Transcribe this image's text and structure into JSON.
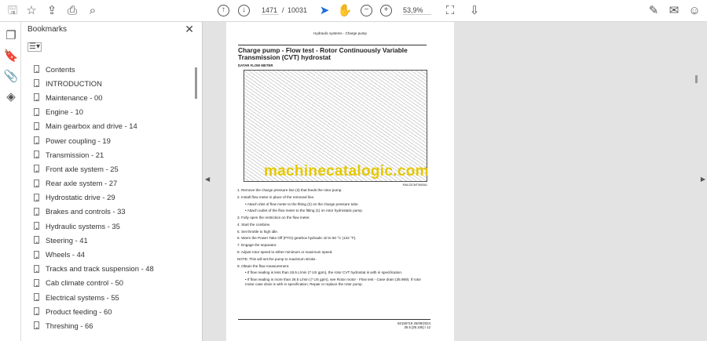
{
  "toolbar": {
    "page_current": "1471",
    "page_sep": "/",
    "page_total": "10031",
    "zoom": "53,9%"
  },
  "bookmarks": {
    "title": "Bookmarks",
    "items": [
      "Contents",
      "INTRODUCTION",
      "Maintenance - 00",
      "Engine - 10",
      "Main gearbox and drive - 14",
      "Power coupling - 19",
      "Transmission - 21",
      "Front axle system - 25",
      "Rear axle system - 27",
      "Hydrostatic drive - 29",
      "Brakes and controls - 33",
      "Hydraulic systems - 35",
      "Steering - 41",
      "Wheels - 44",
      "Tracks and track suspension - 48",
      "Cab climate control - 50",
      "Electrical systems - 55",
      "Product feeding - 60",
      "Threshing - 66"
    ]
  },
  "page": {
    "header": "Hydraulic systems - Charge pump",
    "title": "Charge pump - Flow test - Rotor Continuously Variable Transmission (CVT) hydrostat",
    "subtitle": "DATAR FLOW METER",
    "watermark": "machinecatalogic.com",
    "caption": "RAIL22CMT0600A1",
    "steps": [
      {
        "t": "1. Remove the charge pressure line (3) that feeds the rotor pump.",
        "s": false
      },
      {
        "t": "2. Install flow meter in place of the removed line.",
        "s": false
      },
      {
        "t": "• Attach inlet of flow meter to the fitting (2) on the charge pressure tube.",
        "s": true
      },
      {
        "t": "• Attach outlet of the flow meter to the fitting (1) on rotor hydrostatic pump.",
        "s": true
      },
      {
        "t": "3. Fully open the restriction on the flow meter.",
        "s": false
      },
      {
        "t": "4. Start the combine.",
        "s": false
      },
      {
        "t": "5. Set throttle to high idle.",
        "s": false
      },
      {
        "t": "6. Warm the Power Take Off (PTO) gearbox hydraulic oil to 50 °C (122 °F).",
        "s": false
      },
      {
        "t": "7. Engage the separator.",
        "s": false
      },
      {
        "t": "8. Adjust rotor speed to either minimum or maximum speed.",
        "s": false
      },
      {
        "t": "NOTE: This will set the pump to maximum stroke.",
        "s": false
      },
      {
        "t": "9. Obtain the flow measurement.",
        "s": false
      },
      {
        "t": "• If flow reading is less than 26.5 L/min (7 US gpm), the rotor CVT hydrostat is with in specification.",
        "s": true
      },
      {
        "t": "• If flow reading is more than 26.5 L/min (7 US gpm), see Rotor motor - Flow test - Case drain (35.959). If rotor motor case drain is with in specification, Repair or replace the rotor pump.",
        "s": true
      }
    ],
    "footer_code": "82155719 25/09/2024",
    "footer_page": "35.5 [35.105] / 12"
  }
}
